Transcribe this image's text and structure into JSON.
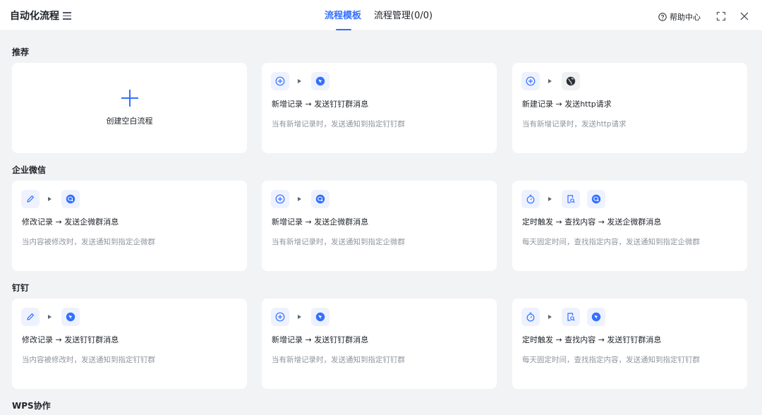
{
  "header": {
    "title": "自动化流程",
    "tabs": [
      {
        "label": "流程模板",
        "active": true
      },
      {
        "label": "流程管理(0/0)",
        "active": false
      }
    ],
    "help_label": "帮助中心"
  },
  "colors": {
    "accent": "#3370ff",
    "background": "#f2f3f5",
    "card": "#ffffff",
    "muted_text": "#8f959e"
  },
  "sections": [
    {
      "title": "推荐",
      "cards": [
        {
          "kind": "blank",
          "label": "创建空白流程",
          "icon": "plus-icon"
        },
        {
          "icons": [
            "add-record-icon",
            "dingtalk-icon"
          ],
          "title": "新增记录 → 发送钉钉群消息",
          "desc": "当有新增记录时，发送通知到指定钉钉群"
        },
        {
          "icons": [
            "add-record-icon",
            "globe-icon"
          ],
          "title": "新建记录 → 发送http请求",
          "desc": "当有新增记录时，发送http请求"
        }
      ]
    },
    {
      "title": "企业微信",
      "cards": [
        {
          "icons": [
            "edit-pencil-icon",
            "wecom-icon"
          ],
          "title": "修改记录 → 发送企微群消息",
          "desc": "当内容被修改时，发送通知到指定企微群"
        },
        {
          "icons": [
            "add-record-icon",
            "wecom-icon"
          ],
          "title": "新增记录 → 发送企微群消息",
          "desc": "当有新增记录时，发送通知到指定企微群"
        },
        {
          "icons": [
            "timer-icon",
            "find-content-icon",
            "wecom-icon"
          ],
          "title": "定时触发 → 查找内容 → 发送企微群消息",
          "desc": "每天固定时间，查找指定内容，发送通知到指定企微群"
        }
      ]
    },
    {
      "title": "钉钉",
      "cards": [
        {
          "icons": [
            "edit-pencil-icon",
            "dingtalk-icon"
          ],
          "title": "修改记录 → 发送钉钉群消息",
          "desc": "当内容被修改时，发送通知到指定钉钉群"
        },
        {
          "icons": [
            "add-record-icon",
            "dingtalk-icon"
          ],
          "title": "新增记录 → 发送钉钉群消息",
          "desc": "当有新增记录时，发送通知到指定钉钉群"
        },
        {
          "icons": [
            "timer-icon",
            "find-content-icon",
            "dingtalk-icon"
          ],
          "title": "定时触发 → 查找内容 → 发送钉钉群消息",
          "desc": "每天固定时间，查找指定内容，发送通知到指定钉钉群"
        }
      ]
    },
    {
      "title": "WPS协作",
      "cards": []
    }
  ]
}
